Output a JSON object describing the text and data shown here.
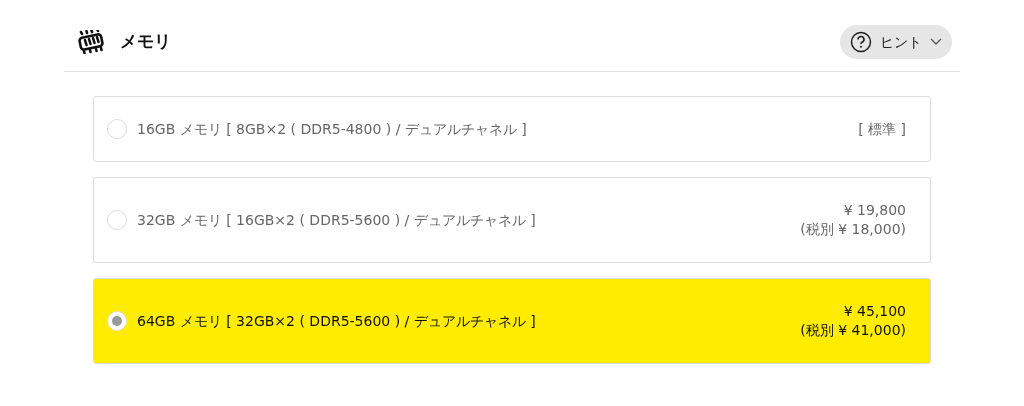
{
  "header": {
    "title": "メモリ",
    "hint_button": {
      "label": "ヒント"
    }
  },
  "options": [
    {
      "label": "16GB メモリ [ 8GB×2 ( DDR5-4800 ) / デュアルチャネル ]",
      "price_lines": [
        "[ 標準 ]"
      ],
      "selected": false
    },
    {
      "label": "32GB メモリ [ 16GB×2 ( DDR5-5600 ) / デュアルチャネル ]",
      "price_lines": [
        "¥ 19,800",
        "(税別 ¥ 18,000)"
      ],
      "selected": false
    },
    {
      "label": "64GB メモリ [ 32GB×2 ( DDR5-5600 ) / デュアルチャネル ]",
      "price_lines": [
        "¥ 45,100",
        "(税別 ¥ 41,000)"
      ],
      "selected": true
    }
  ]
}
